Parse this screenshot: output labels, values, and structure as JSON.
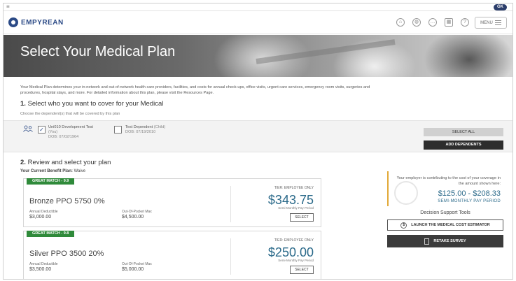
{
  "topstrip": {
    "menu_glyph": "≡",
    "badge": "GK"
  },
  "header": {
    "logo_text": "EMPYREAN",
    "icons": [
      "home-icon",
      "globe-icon",
      "chat-icon",
      "calendar-icon",
      "help-icon"
    ],
    "menu_label": "MENU"
  },
  "hero": {
    "title": "Select Your Medical Plan"
  },
  "intro": "Your Medical Plan determines your in-network and out-of-network health care providers, facilities, and costs for annual check-ups, office visits, urgent care services, emergency room visits, surgeries and procedures, hospital stays, and more. For detailed information about this plan, please visit the Resources Page.",
  "section1": {
    "number": "1.",
    "title": "Select who you want to cover for your Medical",
    "choose": "Choose the dependent(s) that will be covered by this plan"
  },
  "dependents": [
    {
      "name": "Uni010 Development Test",
      "relation": "(You)",
      "dob": "DOB: 07/02/1964",
      "checked": true
    },
    {
      "name": "Test Dependent",
      "relation": "(Child)",
      "dob": "DOB: 07/19/2010",
      "checked": false
    }
  ],
  "buttons": {
    "select_all": "SELECT ALL",
    "add_dependents": "ADD DEPENDENTS"
  },
  "section2": {
    "number": "2.",
    "title": "Review and select your plan",
    "current_label": "Your Current Benefit Plan:",
    "current_value": "Waive"
  },
  "plans": [
    {
      "match": "GREAT MATCH - 9.9",
      "name": "Bronze PPO 5750 0%",
      "deductible_label": "Annual Deductible",
      "deductible": "$3,000.00",
      "oop_label": "Out-Of-Pocket Max",
      "oop": "$4,500.00",
      "tier": "TIER: EMPLOYEE ONLY",
      "price": "$343.75",
      "period": "Semi-Monthly Pay Period",
      "select": "SELECT"
    },
    {
      "match": "GREAT MATCH - 9.8",
      "name": "Silver PPO 3500 20%",
      "deductible_label": "Annual Deductible",
      "deductible": "$3,500.00",
      "oop_label": "Out-Of-Pocket Max",
      "oop": "$5,000.00",
      "tier": "TIER: EMPLOYEE ONLY",
      "price": "$250.00",
      "period": "Semi-Monthly Pay Period",
      "select": "SELECT"
    }
  ],
  "contribution": {
    "text": "Your employer is contributing to the cost of your coverage in the amount shown here:",
    "amount": "$125.00 - $208.33",
    "period": "SEMI-MONTHLY PAY PERIOD"
  },
  "decision_tools": {
    "title": "Decision Support Tools",
    "estimator": "LAUNCH THE MEDICAL COST ESTIMATOR",
    "retake": "RETAKE SURVEY"
  },
  "colors": {
    "brand": "#2b4a86",
    "match_green": "#2f8a3a",
    "price_blue": "#2b6a8a",
    "accent_gold": "#e2a938"
  }
}
